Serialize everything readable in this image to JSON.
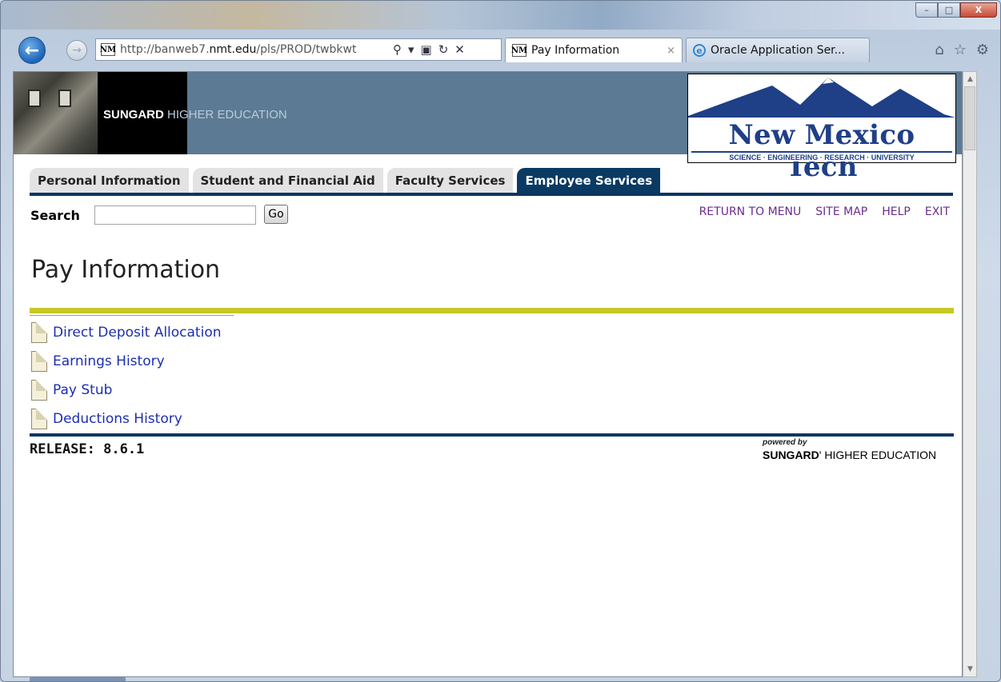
{
  "browser": {
    "url_prefix": "http://banweb7.",
    "url_domain": "nmt.edu",
    "url_suffix": "/pls/PROD/twbkwt",
    "address_favicon": "NM",
    "tabs": [
      {
        "label": "Pay Information",
        "favicon": "NM",
        "close": "×"
      },
      {
        "label": "Oracle Application Ser...",
        "favicon": "e"
      }
    ],
    "window_controls": {
      "minimize": "–",
      "maximize": "□",
      "close": "X"
    },
    "icons": {
      "back": "back-arrow-icon",
      "forward": "forward-arrow-icon",
      "search": "search-icon",
      "refresh": "refresh-icon",
      "stop": "stop-icon",
      "home": "home-icon",
      "favorites": "star-icon",
      "tools": "gear-icon"
    }
  },
  "banner": {
    "brand_bold": "SUNGARD",
    "brand_rest": " HIGHER EDUCATION",
    "logo_name": "New Mexico Tech",
    "logo_sub": "SCIENCE · ENGINEERING · RESEARCH · UNIVERSITY",
    "colors": {
      "banner": "#5c7a93",
      "logo_blue": "#1f3f87"
    }
  },
  "nav_tabs": [
    {
      "label": "Personal Information",
      "active": false
    },
    {
      "label": "Student and Financial Aid",
      "active": false
    },
    {
      "label": "Faculty Services",
      "active": false
    },
    {
      "label": "Employee Services",
      "active": true
    }
  ],
  "search": {
    "label": "Search",
    "value": "",
    "go_label": "Go"
  },
  "top_links": {
    "return": "RETURN TO MENU",
    "site_map": "SITE MAP",
    "help": "HELP",
    "exit": "EXIT"
  },
  "page": {
    "title": "Pay Information",
    "menu": [
      {
        "label": "Direct Deposit Allocation"
      },
      {
        "label": "Earnings History"
      },
      {
        "label": "Pay Stub"
      },
      {
        "label": "Deductions History"
      }
    ]
  },
  "footer": {
    "release": "RELEASE: 8.6.1",
    "powered_by": "powered by",
    "powered_bold": "SUNGARD",
    "powered_rest": "' HIGHER EDUCATION"
  }
}
